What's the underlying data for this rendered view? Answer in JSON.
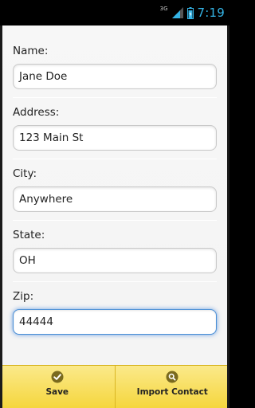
{
  "status_bar": {
    "network_type": "3G",
    "time": "7:19"
  },
  "form": {
    "fields": [
      {
        "label": "Name:",
        "value": "Jane Doe"
      },
      {
        "label": "Address:",
        "value": "123 Main St"
      },
      {
        "label": "City:",
        "value": "Anywhere"
      },
      {
        "label": "State:",
        "value": "OH"
      },
      {
        "label": "Zip:",
        "value": "44444"
      }
    ]
  },
  "toolbar": {
    "save_label": "Save",
    "save_icon": "check-circle-icon",
    "import_label": "Import Contact",
    "import_icon": "search-circle-icon"
  },
  "colors": {
    "status_accent": "#34b4e6",
    "toolbar_yellow": "#f5d63d",
    "focus_blue": "#4a8fd6"
  }
}
